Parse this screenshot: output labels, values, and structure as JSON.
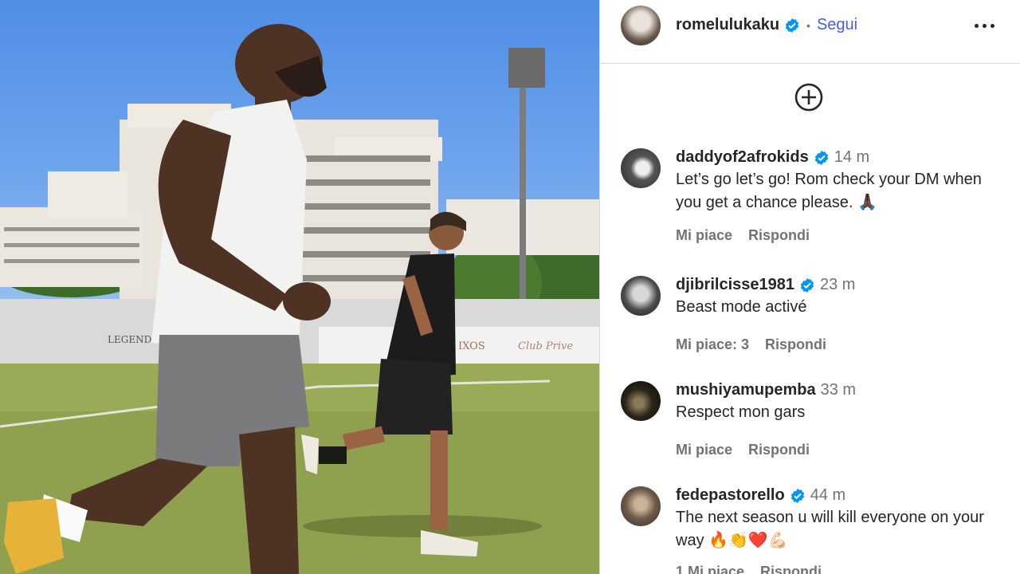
{
  "post": {
    "author": "romelulukaku",
    "follow_label": "Segui",
    "separator": "•"
  },
  "icons": {
    "verified": "verified-badge-icon",
    "more": "more-options-icon",
    "add": "plus-circle-icon"
  },
  "colors": {
    "verified": "#0095f6",
    "follow": "#4a5df0",
    "muted": "#737373"
  },
  "comments": [
    {
      "username": "daddyof2afrokids",
      "verified": true,
      "time": "14 m",
      "text": "Let’s go let’s go! Rom check your DM when you get a chance please. 🙏🏿",
      "like_label": "Mi piace",
      "reply_label": "Rispondi"
    },
    {
      "username": "djibrilcisse1981",
      "verified": true,
      "time": "23 m",
      "text": "Beast mode activé",
      "like_label": "Mi piace: 3",
      "reply_label": "Rispondi"
    },
    {
      "username": "mushiyamupemba",
      "verified": false,
      "time": "33 m",
      "text": "Respect mon gars",
      "like_label": "Mi piace",
      "reply_label": "Rispondi"
    },
    {
      "username": "fedepastorello",
      "verified": true,
      "time": "44 m",
      "text": "The next season u will kill everyone on your way 🔥👏❤️💪🏻",
      "like_label": "1 Mi piace",
      "reply_label": "Rispondi"
    }
  ],
  "media": {
    "banner_text_1": "LEGENDS",
    "banner_text_2": "IXOS",
    "banner_text_3": "Club Prive"
  }
}
